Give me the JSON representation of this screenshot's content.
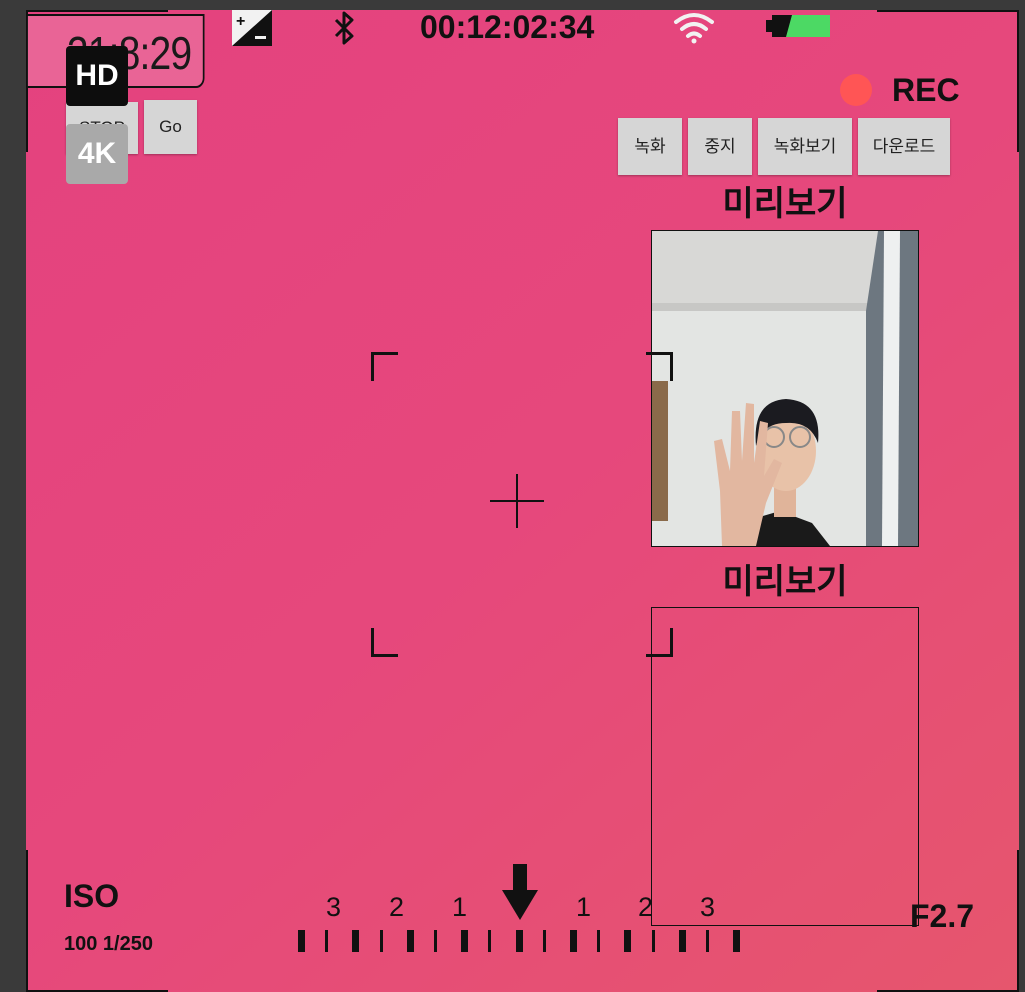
{
  "status_bar": {
    "exposure_icon": "exposure-plus-minus-icon",
    "bluetooth_icon": "bluetooth-icon",
    "timecode": "00:12:02:34",
    "wifi_icon": "wifi-icon",
    "battery_icon": "battery-icon",
    "battery_color": "#4cd964"
  },
  "clock": {
    "value": "21:8:29"
  },
  "quality": {
    "hd_label": "HD",
    "k4_label": "4K"
  },
  "left_buttons": {
    "stop_label": "STOP",
    "go_label": "Go"
  },
  "rec": {
    "label": "REC",
    "dot_color": "#ff5555"
  },
  "controls": {
    "record": "녹화",
    "stop": "중지",
    "view_recording": "녹화보기",
    "download": "다운로드"
  },
  "previews": [
    {
      "title": "미리보기"
    },
    {
      "title": "미리보기"
    }
  ],
  "exposure_scale": {
    "labels_left": [
      "3",
      "2",
      "1"
    ],
    "labels_right": [
      "1",
      "2",
      "3"
    ],
    "arrow_icon": "down-arrow-icon"
  },
  "iso": {
    "label": "ISO",
    "detail": "100 1/250"
  },
  "aperture": {
    "value": "F2.7"
  },
  "colors": {
    "background_start": "#e4427f",
    "background_end": "#e6566d"
  }
}
